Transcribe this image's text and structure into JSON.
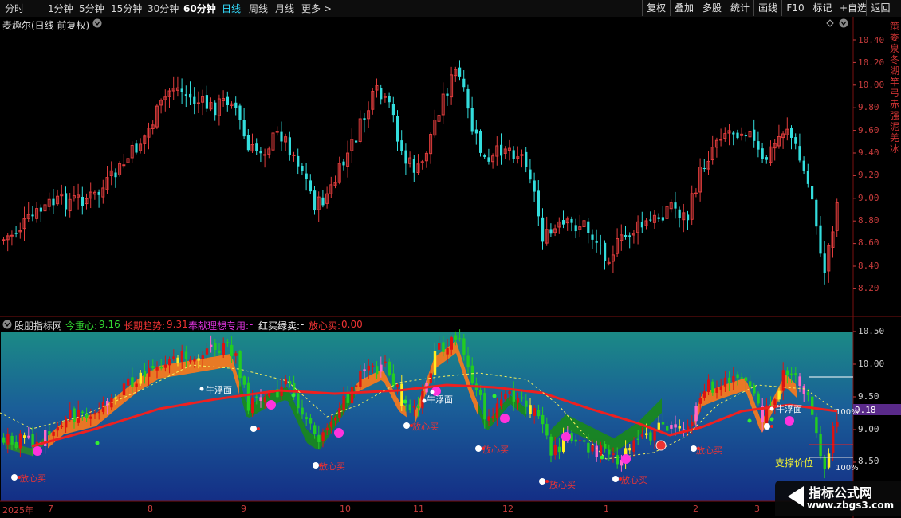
{
  "toolbar": {
    "periods": [
      "分时",
      "1分钟",
      "5分钟",
      "15分钟",
      "30分钟",
      "60分钟",
      "日线",
      "周线",
      "月线",
      "更多 >"
    ],
    "active_period": "日线",
    "right_buttons": [
      "复权",
      "叠加",
      "多股",
      "统计",
      "画线",
      "F10",
      "标记",
      "+自选",
      "返回"
    ]
  },
  "main": {
    "title": "麦趣尔(日线 前复权)",
    "y_ticks": [
      "10.40",
      "10.20",
      "10.00",
      "9.80",
      "9.60",
      "9.40",
      "9.20",
      "9.00",
      "8.80",
      "8.60",
      "8.40",
      "8.20"
    ],
    "side_text": "策委泉冬湖竿弓赤强泥羌冰"
  },
  "sub": {
    "indicator_name": "股朋指标网",
    "legend": [
      {
        "label": "今重心:",
        "value": "9.16",
        "color": "#33dd33"
      },
      {
        "label": "长期趋势:",
        "value": "9.31",
        "color": "#ee3333"
      },
      {
        "label": "奉献理想专用:",
        "value": "-",
        "color": "#dd33dd"
      },
      {
        "label": "红买绿卖:",
        "value": "-",
        "color": "#eeeeee"
      },
      {
        "label": "放心买:",
        "value": "0.00",
        "color": "#ee3333"
      }
    ],
    "y_ticks": [
      "10.50",
      "10.00",
      "9.50",
      "9.00",
      "8.50"
    ],
    "current_value": "9.18",
    "dates": [
      "2025年",
      "7",
      "8",
      "9",
      "10",
      "11",
      "12",
      "1",
      "2",
      "3"
    ],
    "annotations": [
      {
        "text": "放心买",
        "type": "buy"
      },
      {
        "text": "牛浮面",
        "type": "bull"
      },
      {
        "text": "放心买",
        "type": "buy"
      },
      {
        "text": "放心买",
        "type": "buy"
      },
      {
        "text": "牛浮面",
        "type": "bull"
      },
      {
        "text": "放心买",
        "type": "buy"
      },
      {
        "text": "放心买",
        "type": "buy"
      },
      {
        "text": "放心买",
        "type": "buy"
      },
      {
        "text": "放心买",
        "type": "buy"
      },
      {
        "text": "牛浮面",
        "type": "bull"
      }
    ],
    "support_label": "支撑价位",
    "level_labels": [
      "100%",
      "100%"
    ],
    "watermark": {
      "title": "指标公式网",
      "url": "www.zbgs3.com"
    }
  },
  "colors": {
    "up": "#e03c3c",
    "down": "#33dddd",
    "sub_up": "#dd1111",
    "sub_down": "#22cc22",
    "bg": "#000000"
  }
}
